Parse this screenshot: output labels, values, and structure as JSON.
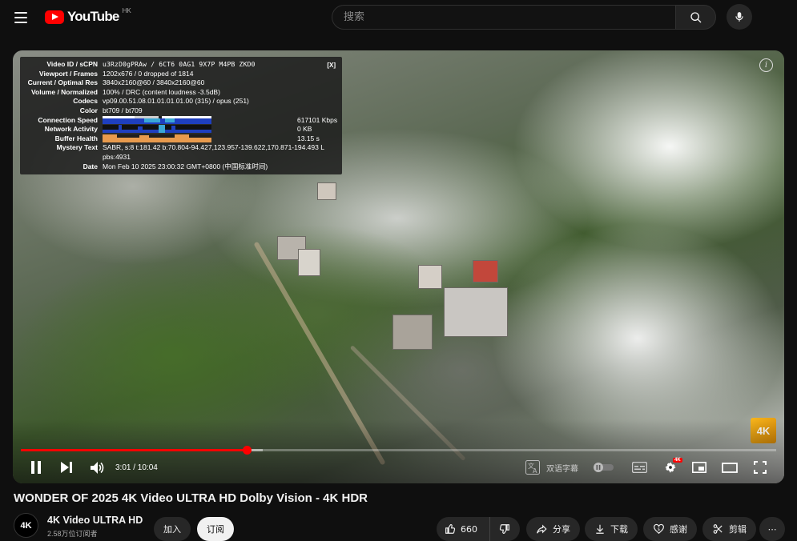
{
  "masthead": {
    "logo_text": "YouTube",
    "region": "HK",
    "search_placeholder": "搜索"
  },
  "player": {
    "stats": {
      "close_label": "[X]",
      "rows": [
        {
          "key": "Video ID / sCPN",
          "value": "u3RzD0gPRAw  /  6CT6 0AG1 9X7P M4PB ZKD0"
        },
        {
          "key": "Viewport / Frames",
          "value": "1202x676 / 0 dropped of 1814"
        },
        {
          "key": "Current / Optimal Res",
          "value": "3840x2160@60 / 3840x2160@60"
        },
        {
          "key": "Volume / Normalized",
          "value": "100% / DRC (content loudness -3.5dB)"
        },
        {
          "key": "Codecs",
          "value": "vp09.00.51.08.01.01.01.01.00 (315) / opus (251)"
        },
        {
          "key": "Color",
          "value": "bt709 / bt709"
        }
      ],
      "connection_speed": {
        "key": "Connection Speed",
        "value": "617101 Kbps"
      },
      "network_activity": {
        "key": "Network Activity",
        "value": "0 KB"
      },
      "buffer_health": {
        "key": "Buffer Health",
        "value": "13.15 s"
      },
      "mystery_text": {
        "key": "Mystery Text",
        "value": "SABR, s:8 t:181.42 b:70.804-94.427,123.957-139.622,170.871-194.493 L",
        "value2": "pbs:4931"
      },
      "date": {
        "key": "Date",
        "value": "Mon Feb 10 2025 23:00:32 GMT+0800 (中国标准时间)"
      }
    },
    "info_label": "i",
    "quality_badge": "4K",
    "progress": {
      "played_fraction": 0.299,
      "loaded_fraction": 0.32
    },
    "time": "3:01 / 10:04",
    "subtitle_label": "双语字幕",
    "settings_badge": "4K"
  },
  "video": {
    "title": "WONDER OF 2025 4K Video ULTRA HD Dolby Vision - 4K HDR",
    "channel": "4K Video ULTRA HD",
    "avatar_text": "4K",
    "subscribers": "2.58万位订阅者",
    "join_label": "加入",
    "subscribe_label": "订阅",
    "like_count": "660",
    "share_label": "分享",
    "download_label": "下载",
    "thanks_label": "感谢",
    "clip_label": "剪辑",
    "more_label": "⋯"
  },
  "colors": {
    "accent": "#ff0000",
    "background": "#0f0f0f",
    "pill": "#272727"
  },
  "icons": [
    "menu-icon",
    "youtube-logo-icon",
    "search-icon",
    "mic-icon",
    "info-icon",
    "pause-icon",
    "next-icon",
    "volume-icon",
    "subtitle-translate-icon",
    "autoplay-toggle",
    "captions-icon",
    "settings-icon",
    "miniplayer-icon",
    "theater-icon",
    "fullscreen-icon",
    "like-icon",
    "dislike-icon",
    "share-icon",
    "download-icon",
    "thanks-icon",
    "clip-icon"
  ]
}
